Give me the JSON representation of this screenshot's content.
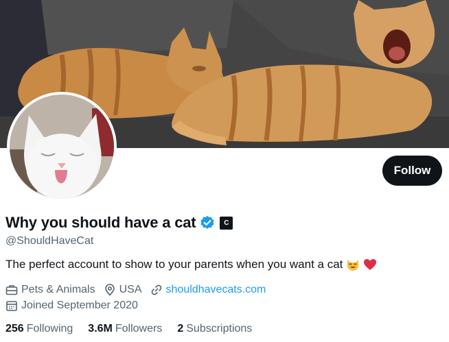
{
  "banner": {
    "alt": "two orange tabby cats lying on a grey couch"
  },
  "profile": {
    "display_name": "Why you should have a cat",
    "handle": "@ShouldHaveCat",
    "bio": "The perfect account to show to your parents when you want a cat",
    "bio_emojis": [
      "smiling-cat-emoji",
      "red-heart-emoji"
    ],
    "verified_badge": "verified-check-icon",
    "affiliation_badge": "C",
    "category": "Pets & Animals",
    "location": "USA",
    "website": "shouldhavecats.com",
    "joined": "Joined September 2020"
  },
  "actions": {
    "follow_label": "Follow"
  },
  "stats": {
    "following_count": "256",
    "following_label": "Following",
    "followers_count": "3.6M",
    "followers_label": "Followers",
    "subscriptions_count": "2",
    "subscriptions_label": "Subscriptions"
  },
  "colors": {
    "link": "#1d9bf0",
    "verified": "#1d9bf0",
    "text": "#0f1419",
    "muted": "#536471",
    "button_bg": "#0f1419"
  },
  "icons": [
    "briefcase-icon",
    "location-pin-icon",
    "link-icon",
    "calendar-icon"
  ]
}
